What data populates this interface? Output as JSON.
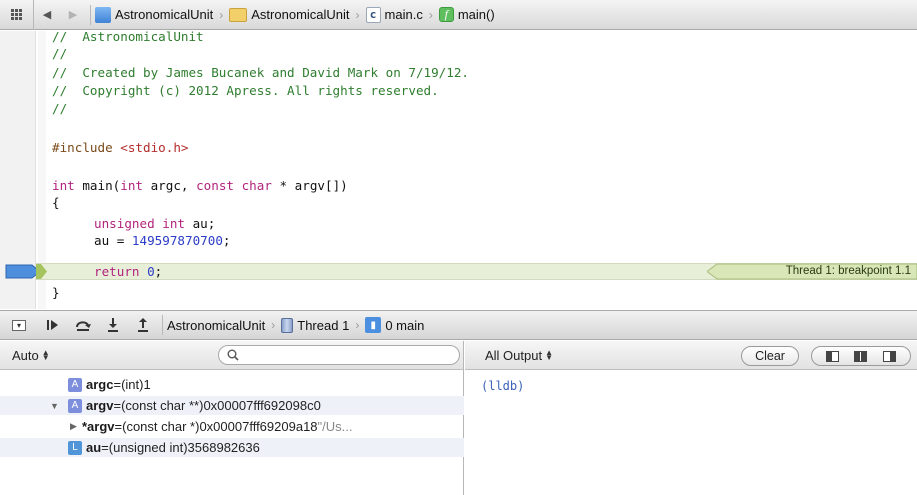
{
  "jumpbar": {
    "breadcrumbs": [
      {
        "label": "AstronomicalUnit",
        "icon": "project-icon"
      },
      {
        "label": "AstronomicalUnit",
        "icon": "folder-icon"
      },
      {
        "label": "main.c",
        "icon": "c-file-icon"
      },
      {
        "label": "main()",
        "icon": "function-icon"
      }
    ]
  },
  "editor": {
    "lines": [
      {
        "comment": "//  AstronomicalUnit"
      },
      {
        "comment": "//"
      },
      {
        "comment": "//  Created by James Bucanek and David Mark on 7/19/12."
      },
      {
        "comment": "//  Copyright (c) 2012 Apress. All rights reserved."
      },
      {
        "comment": "//"
      }
    ],
    "include_directive": "#include",
    "include_file": "<stdio.h>",
    "sig_int": "int",
    "sig_main": " main(",
    "sig_int2": "int",
    "sig_argc": " argc, ",
    "sig_const": "const",
    "sig_char": " char",
    "sig_rest": " * argv[])",
    "open_brace": "{",
    "decl_kw": "unsigned int",
    "decl_var": " au;",
    "assign_lhs": "au = ",
    "assign_num": "149597870700",
    "assign_end": ";",
    "return_kw": "return",
    "return_num": " 0",
    "return_end": ";",
    "close_brace": "}",
    "breakpoint_label": "Thread 1: breakpoint 1.1",
    "colors": {
      "comment": "#2f7d2f",
      "keyword": "#b1247d",
      "number": "#2b3cc6",
      "current_line": "#e8efd9",
      "breakpoint": "#4d8fdc"
    }
  },
  "debugbar": {
    "crumbs": [
      {
        "label": "AstronomicalUnit",
        "icon": "project-icon"
      },
      {
        "label": "Thread 1",
        "icon": "thread-icon"
      },
      {
        "label": "0 main",
        "icon": "stack-frame-icon"
      }
    ]
  },
  "variables": {
    "scope": "Auto",
    "search_value": "",
    "rows": [
      {
        "name": "argc",
        "eq": " = ",
        "type": "(int)",
        "value": " 1",
        "badge": "A"
      },
      {
        "name": "argv",
        "eq": " = ",
        "type": "(const char **)",
        "value": " 0x00007fff692098c0",
        "badge": "A"
      },
      {
        "name": "*argv",
        "eq": " = ",
        "type": "(const char *)",
        "value": " 0x00007fff69209a18",
        "summary": " \"/Us...",
        "badge": ""
      },
      {
        "name": "au",
        "eq": " = ",
        "type": "(unsigned int)",
        "value": " 3568982636",
        "badge": "L"
      }
    ]
  },
  "output": {
    "selector": "All Output",
    "clear_label": "Clear",
    "console_text": "(lldb)"
  }
}
